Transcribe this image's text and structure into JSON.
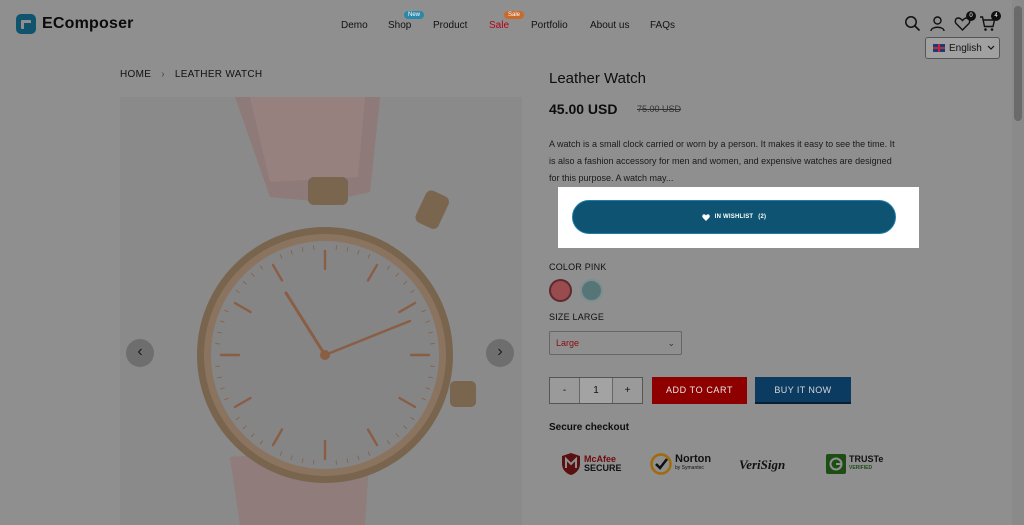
{
  "brand": {
    "name": "EComposer"
  },
  "nav": {
    "items": [
      {
        "label": "Demo"
      },
      {
        "label": "Shop",
        "badge": "New"
      },
      {
        "label": "Product"
      },
      {
        "label": "Sale",
        "badge": "Sale"
      },
      {
        "label": "Portfolio"
      },
      {
        "label": "About us"
      },
      {
        "label": "FAQs"
      }
    ]
  },
  "header": {
    "wishlist_count": "0",
    "cart_count": "4",
    "language": "English"
  },
  "breadcrumb": {
    "home": "HOME",
    "current": "LEATHER WATCH"
  },
  "product": {
    "title": "Leather Watch",
    "price": "45.00 USD",
    "compare_price": "75.00 USD",
    "description": "A watch is a small clock carried or worn by a person. It makes it easy to see the time. It is also a fashion accessory for men and women, and expensive watches are designed for this purpose. A watch may...",
    "wishlist_label": "IN WISHLIST",
    "wishlist_count": "(2)",
    "color_label": "COLOR PINK",
    "size_label": "SIZE LARGE",
    "size_value": "Large",
    "quantity": "1",
    "qty_minus": "-",
    "qty_plus": "+",
    "add_to_cart": "ADD TO CART",
    "buy_now": "BUY IT NOW",
    "secure_checkout": "Secure checkout"
  },
  "trust_badges": [
    {
      "line1": "McAfee",
      "line2": "SECURE"
    },
    {
      "line1": "Norton",
      "line2": "by Symantec"
    },
    {
      "line1": "VeriSign",
      "line2": ""
    },
    {
      "line1": "TRUSTe",
      "line2": "VERIFIED"
    }
  ],
  "colors": {
    "accent": "#0e5472",
    "add_to_cart": "#8e0000",
    "buy_now": "#0c3b62",
    "sale": "#b4001a"
  }
}
